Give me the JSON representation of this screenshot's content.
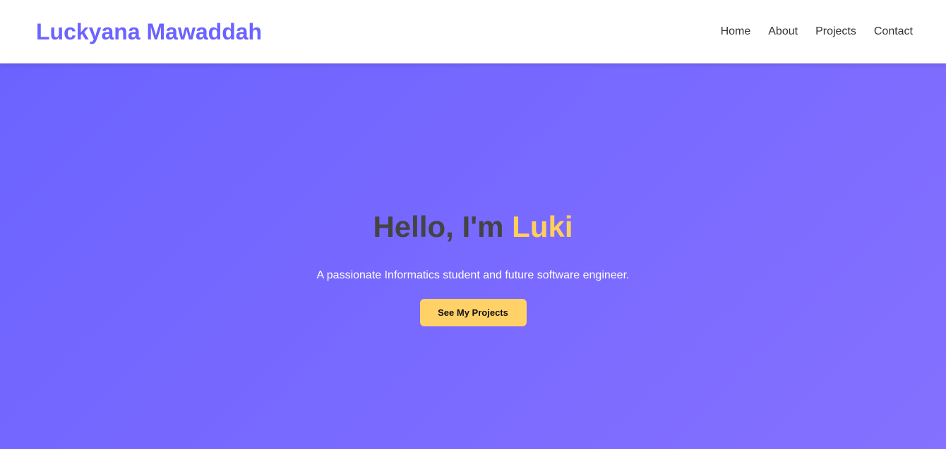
{
  "navbar": {
    "brand": "Luckyana Mawaddah",
    "links": [
      {
        "label": "Home"
      },
      {
        "label": "About"
      },
      {
        "label": "Projects"
      },
      {
        "label": "Contact"
      }
    ]
  },
  "hero": {
    "title_prefix": "Hello, I'm ",
    "title_highlight": "Luki",
    "subtitle": "A passionate Informatics student and future software engineer.",
    "cta_label": "See My Projects"
  },
  "colors": {
    "brand": "#6c63ff",
    "hero_gradient_start": "#6c63ff",
    "hero_gradient_end": "#8570ff",
    "highlight": "#ffcf5c",
    "cta_background": "#ffd166"
  }
}
